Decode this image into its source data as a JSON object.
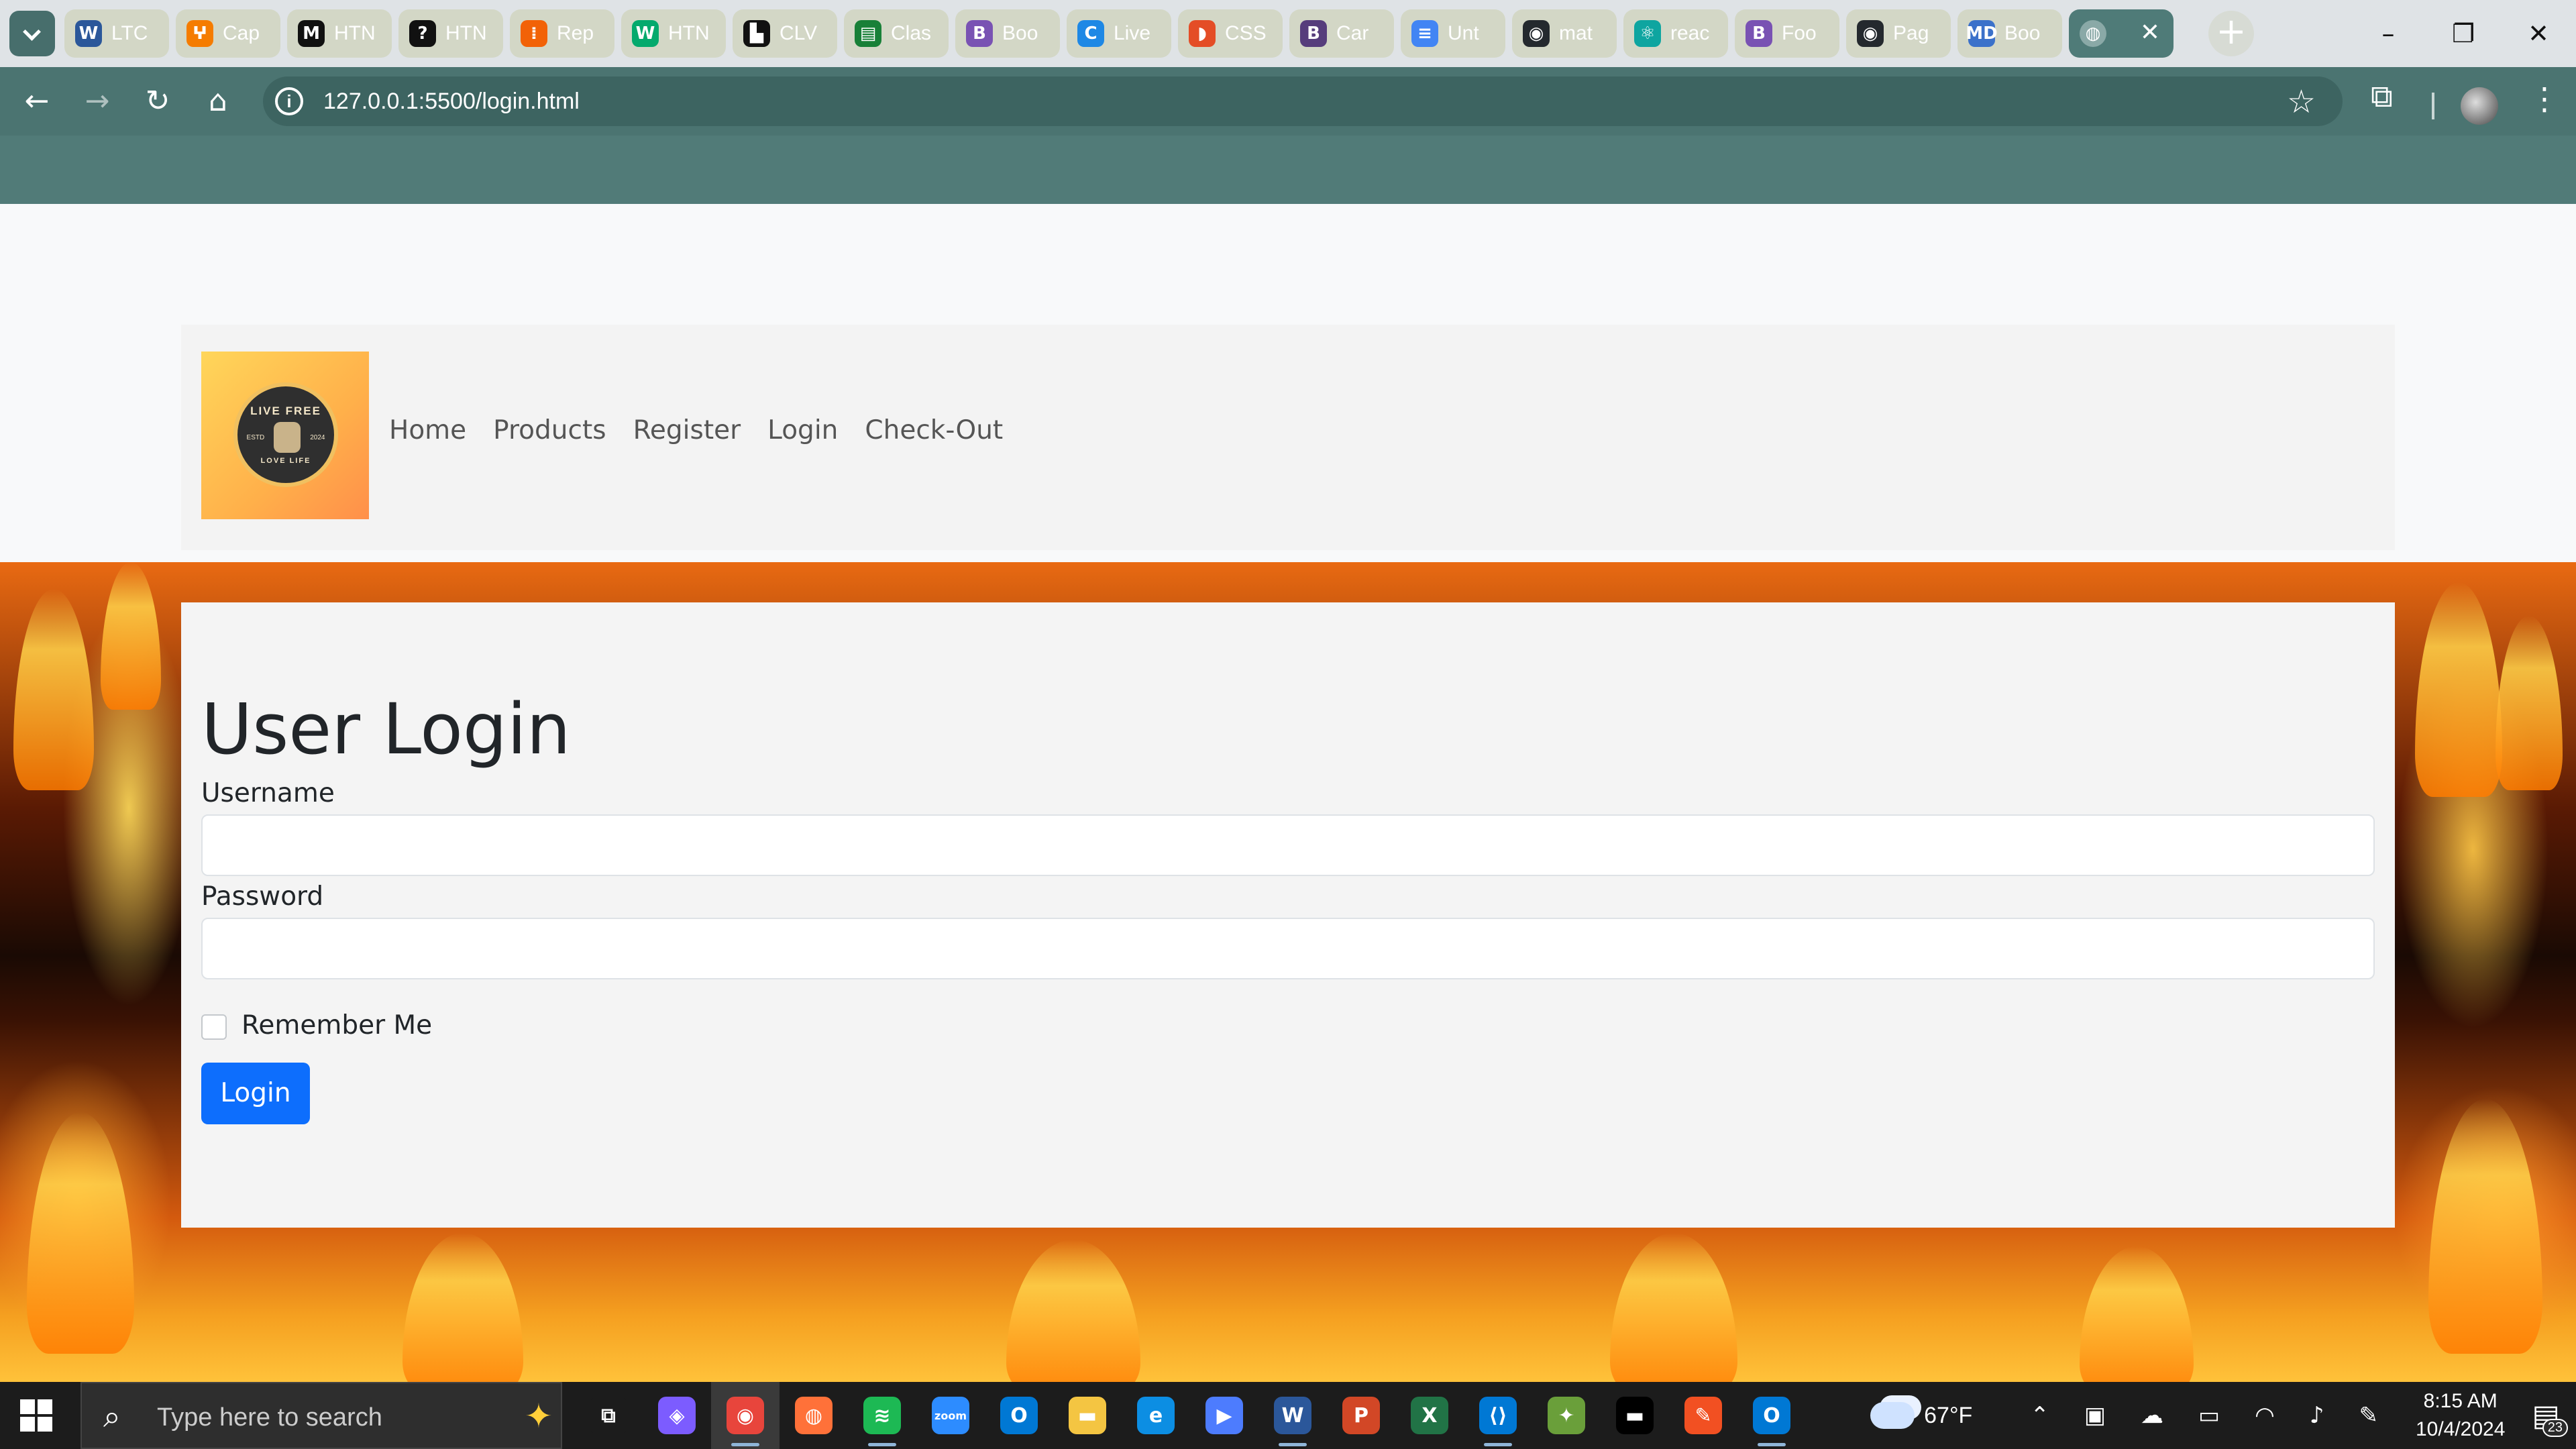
{
  "browser": {
    "tabs": [
      {
        "title": "LTC",
        "icon": "word-icon",
        "color": "#2b579a",
        "glyph": "W"
      },
      {
        "title": "Cap",
        "icon": "capstone-icon",
        "color": "#f57c00",
        "glyph": "ⵖ"
      },
      {
        "title": "HTN",
        "icon": "m-icon",
        "color": "#111111",
        "glyph": "M"
      },
      {
        "title": "HTN",
        "icon": "question-icon",
        "color": "#111111",
        "glyph": "?"
      },
      {
        "title": "Rep",
        "icon": "replit-icon",
        "color": "#f26207",
        "glyph": "⁞"
      },
      {
        "title": "HTN",
        "icon": "w3schools-icon",
        "color": "#04aa6d",
        "glyph": "W"
      },
      {
        "title": "CLV",
        "icon": "clv-icon",
        "color": "#111111",
        "glyph": "▙"
      },
      {
        "title": "Clas",
        "icon": "classroom-icon",
        "color": "#188038",
        "glyph": "▤"
      },
      {
        "title": "Boo",
        "icon": "bootstrap-icon",
        "color": "#7952b3",
        "glyph": "B"
      },
      {
        "title": "Live",
        "icon": "c-icon",
        "color": "#1e88e5",
        "glyph": "C"
      },
      {
        "title": "CSS",
        "icon": "css-icon",
        "color": "#e44d26",
        "glyph": "◗"
      },
      {
        "title": "Car",
        "icon": "bootstrap-icon",
        "color": "#563d7c",
        "glyph": "B"
      },
      {
        "title": "Unt",
        "icon": "docs-icon",
        "color": "#4285f4",
        "glyph": "≡"
      },
      {
        "title": "mat",
        "icon": "github-icon",
        "color": "#24292e",
        "glyph": "◉"
      },
      {
        "title": "reac",
        "icon": "react-icon",
        "color": "#0ea5a0",
        "glyph": "⚛"
      },
      {
        "title": "Foo",
        "icon": "bootstrap-icon",
        "color": "#7952b3",
        "glyph": "B"
      },
      {
        "title": "Pag",
        "icon": "github-icon",
        "color": "#24292e",
        "glyph": "◉"
      },
      {
        "title": "Boo",
        "icon": "mdb-icon",
        "color": "#3b71ca",
        "glyph": "MD"
      }
    ],
    "active_tab": {
      "close": "✕"
    },
    "new_tab": "+",
    "window": {
      "minimize": "–",
      "maximize": "❐",
      "close": "✕"
    },
    "url": "127.0.0.1:5500/login.html",
    "nav": {
      "back": "←",
      "forward": "→",
      "reload": "↻",
      "home": "⌂"
    },
    "star": "☆",
    "extensions": "⧉",
    "menu": "⋮"
  },
  "site": {
    "logo": {
      "top": "LIVE FREE",
      "left": "ESTD",
      "right": "2024",
      "bottom": "LOVE LIFE"
    },
    "nav": [
      "Home",
      "Products",
      "Register",
      "Login",
      "Check-Out"
    ]
  },
  "login": {
    "title": "User Login",
    "username_label": "Username",
    "username_value": "",
    "password_label": "Password",
    "password_value": "",
    "remember_label": "Remember Me",
    "remember_checked": false,
    "submit": "Login"
  },
  "taskbar": {
    "search_placeholder": "Type here to search",
    "apps": [
      {
        "name": "task-view",
        "glyph": "⧉",
        "color": "#1c1c1c",
        "running": false
      },
      {
        "name": "copilot",
        "glyph": "◈",
        "color": "#7c5cff",
        "running": false
      },
      {
        "name": "chrome",
        "glyph": "◉",
        "color": "#e8453c",
        "running": true,
        "active": true
      },
      {
        "name": "firefox",
        "glyph": "◍",
        "color": "#ff7139",
        "running": false
      },
      {
        "name": "spotify",
        "glyph": "≋",
        "color": "#1db954",
        "running": true
      },
      {
        "name": "zoom",
        "glyph": "zoom",
        "color": "#2d8cff",
        "running": false
      },
      {
        "name": "outlook",
        "glyph": "O",
        "color": "#0078d4",
        "running": false
      },
      {
        "name": "file-explorer",
        "glyph": "▬",
        "color": "#f4c542",
        "running": false
      },
      {
        "name": "edge",
        "glyph": "e",
        "color": "#0c8ee3",
        "running": false
      },
      {
        "name": "clipchamp",
        "glyph": "▶",
        "color": "#4d7cfe",
        "running": false
      },
      {
        "name": "word",
        "glyph": "W",
        "color": "#2b579a",
        "running": true
      },
      {
        "name": "powerpoint",
        "glyph": "P",
        "color": "#d24726",
        "running": false
      },
      {
        "name": "excel",
        "glyph": "X",
        "color": "#217346",
        "running": false
      },
      {
        "name": "vscode",
        "glyph": "⟨⟩",
        "color": "#0078d4",
        "running": true
      },
      {
        "name": "git-gui",
        "glyph": "✦",
        "color": "#6a9f3a",
        "running": false
      },
      {
        "name": "terminal",
        "glyph": "▬",
        "color": "#000000",
        "running": false
      },
      {
        "name": "pencil-app",
        "glyph": "✎",
        "color": "#f25022",
        "running": false
      },
      {
        "name": "outlook-new",
        "glyph": "O",
        "color": "#0078d4",
        "running": true
      }
    ],
    "weather": {
      "temp": "67°F"
    },
    "time": "8:15 AM",
    "date": "10/4/2024",
    "notifications": "23"
  }
}
